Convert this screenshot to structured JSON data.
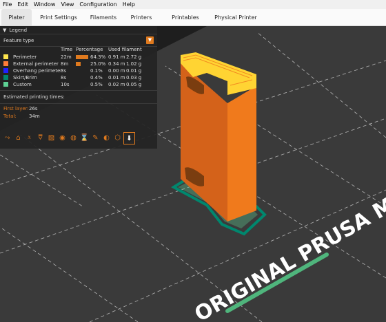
{
  "menu": [
    "File",
    "Edit",
    "Window",
    "View",
    "Configuration",
    "Help"
  ],
  "tabs": [
    {
      "label": "Plater",
      "active": true
    },
    {
      "label": "Print Settings",
      "active": false
    },
    {
      "label": "Filaments",
      "active": false
    },
    {
      "label": "Printers",
      "active": false
    },
    {
      "label": "Printables",
      "active": false
    },
    {
      "label": "Physical Printer",
      "active": false
    }
  ],
  "legend": {
    "title": "Legend",
    "view_type": "Feature type",
    "columns": {
      "time": "Time",
      "percentage": "Percentage",
      "used_filament": "Used filament"
    },
    "rows": [
      {
        "name": "Perimeter",
        "color": "#ffe64d",
        "time": "22m",
        "pct_value": 64.3,
        "percentage": "64.3%",
        "length": "0.91 m",
        "weight": "2.72 g"
      },
      {
        "name": "External perimeter",
        "color": "#ff7d38",
        "time": "8m",
        "pct_value": 25.0,
        "percentage": "25.0%",
        "length": "0.34 m",
        "weight": "1.02 g"
      },
      {
        "name": "Overhang perimeter",
        "color": "#1f1fff",
        "time": "3s",
        "pct_value": 0.1,
        "percentage": "0.1%",
        "length": "0.00 m",
        "weight": "0.01 g"
      },
      {
        "name": "Skirt/Brim",
        "color": "#00876e",
        "time": "8s",
        "pct_value": 0.4,
        "percentage": "0.4%",
        "length": "0.01 m",
        "weight": "0.03 g"
      },
      {
        "name": "Custom",
        "color": "#5ed194",
        "time": "10s",
        "pct_value": 0.5,
        "percentage": "0.5%",
        "length": "0.02 m",
        "weight": "0.05 g"
      }
    ],
    "estimated_label": "Estimated printing times:",
    "first_layer_label": "First layer:",
    "first_layer_value": "26s",
    "total_label": "Total:",
    "total_value": "34m",
    "toolbar_icons": [
      "travel-icon",
      "wipe-icon",
      "retractions-icon",
      "deretractions-icon",
      "seams-icon",
      "tool-changes-icon",
      "color-changes-icon",
      "pause-prints-icon",
      "custom-gcodes-icon",
      "center-of-gravity-icon",
      "shells-icon",
      "tool-marker-icon"
    ]
  },
  "bed": {
    "text": "ORIGINAL PRUSA MINI"
  },
  "colors": {
    "accent": "#e07a1e",
    "model": "#f07a1c"
  }
}
